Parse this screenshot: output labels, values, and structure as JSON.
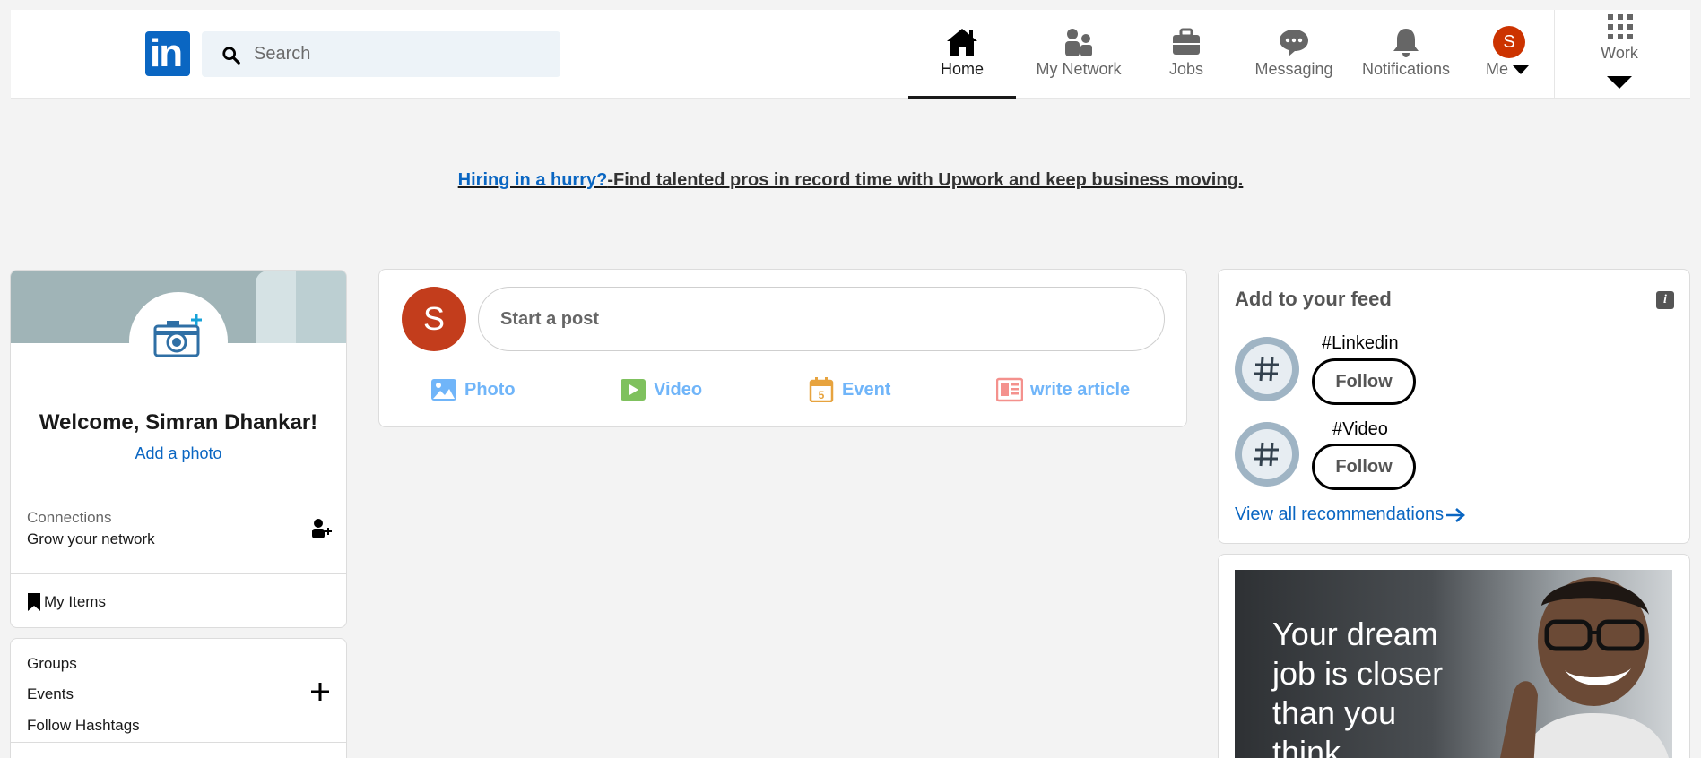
{
  "nav": {
    "search_placeholder": "Search",
    "items": [
      {
        "label": "Home",
        "icon": "home-icon"
      },
      {
        "label": "My Network",
        "icon": "network-icon"
      },
      {
        "label": "Jobs",
        "icon": "briefcase-icon"
      },
      {
        "label": "Messaging",
        "icon": "chat-icon"
      },
      {
        "label": "Notifications",
        "icon": "bell-icon"
      },
      {
        "label": "Me",
        "avatar_letter": "S"
      },
      {
        "label": "Work",
        "icon": "grid-icon"
      }
    ],
    "logo_text": "in"
  },
  "promo": {
    "link": "Hiring in a hurry?",
    "text": "-Find talented pros in record time with Upwork and keep business moving."
  },
  "profile": {
    "welcome": "Welcome, Simran Dhankar!",
    "add_photo": "Add a photo",
    "connections_label": "Connections",
    "connections_sub": "Grow your network",
    "my_items": "My Items"
  },
  "groups": {
    "items": [
      "Groups",
      "Events",
      "Follow Hashtags"
    ]
  },
  "composer": {
    "avatar_letter": "S",
    "placeholder": "Start a post",
    "actions": [
      {
        "label": "Photo",
        "icon": "photo-icon"
      },
      {
        "label": "Video",
        "icon": "video-icon"
      },
      {
        "label": "Event",
        "icon": "calendar-icon",
        "badge": "5"
      },
      {
        "label": "write article",
        "icon": "article-icon"
      }
    ]
  },
  "feed": {
    "title": "Add to your feed",
    "info": "i",
    "recommendations": [
      {
        "tag": "#Linkedin",
        "button": "Follow"
      },
      {
        "tag": "#Video",
        "button": "Follow"
      }
    ],
    "view_all": "View all recommendations"
  },
  "ad": {
    "text": "Your dream job is closer than you think"
  },
  "colors": {
    "brand": "#0a66c2",
    "avatar": "#cc3300",
    "photo": "#70b5f9",
    "video": "#7fc15e",
    "event": "#e7a33e",
    "article": "#fc9295"
  }
}
